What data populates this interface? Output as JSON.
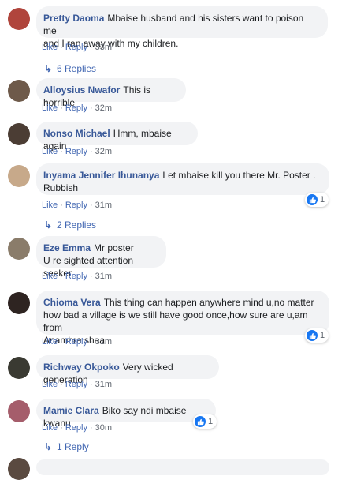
{
  "actions": {
    "like": "Like",
    "reply": "Reply",
    "sep": "·"
  },
  "comments": [
    {
      "author": "Pretty Daoma",
      "line1": "Mbaise husband and his sisters want to poison me",
      "line2": "and I ran away with my children.",
      "time": "33m",
      "replies": "6 Replies",
      "avatar_color": "#b0453c"
    },
    {
      "author": "Alloysius Nwafor",
      "text": "This is horrible",
      "time": "32m",
      "avatar_color": "#6e5a4a"
    },
    {
      "author": "Nonso Michael",
      "text": "Hmm, mbaise again",
      "time": "32m",
      "avatar_color": "#4b3d34"
    },
    {
      "author": "Inyama Jennifer Ihunanya",
      "line1": "Let mbaise kill you there Mr. Poster .",
      "line2": "Rubbish",
      "time": "31m",
      "replies": "2 Replies",
      "reaction": "1",
      "avatar_color": "#c7a98a"
    },
    {
      "author": "Eze Emma",
      "line1": "Mr poster",
      "line2": "U re sighted attention seeker",
      "time": "31m",
      "avatar_color": "#8a7c6a"
    },
    {
      "author": "Chioma Vera",
      "line1": "This thing can happen anywhere mind u,no matter",
      "line2": "how bad a village is we still have good once,how sure are u,am from",
      "line3": "Anambra shaa",
      "time": "31m",
      "reaction": "1",
      "avatar_color": "#2e2421"
    },
    {
      "author": "Richway Okpoko",
      "text": "Very wicked generation",
      "time": "31m",
      "avatar_color": "#3a3a32"
    },
    {
      "author": "Mamie Clara",
      "text": "Biko say ndi mbaise kwanu",
      "time": "30m",
      "replies": "1 Reply",
      "reaction": "1",
      "avatar_color": "#a55d6b"
    }
  ],
  "colors": {
    "link": "#385898",
    "action": "#4267b2",
    "bubble": "#f2f3f5",
    "reaction_blue": "#1877f2"
  }
}
